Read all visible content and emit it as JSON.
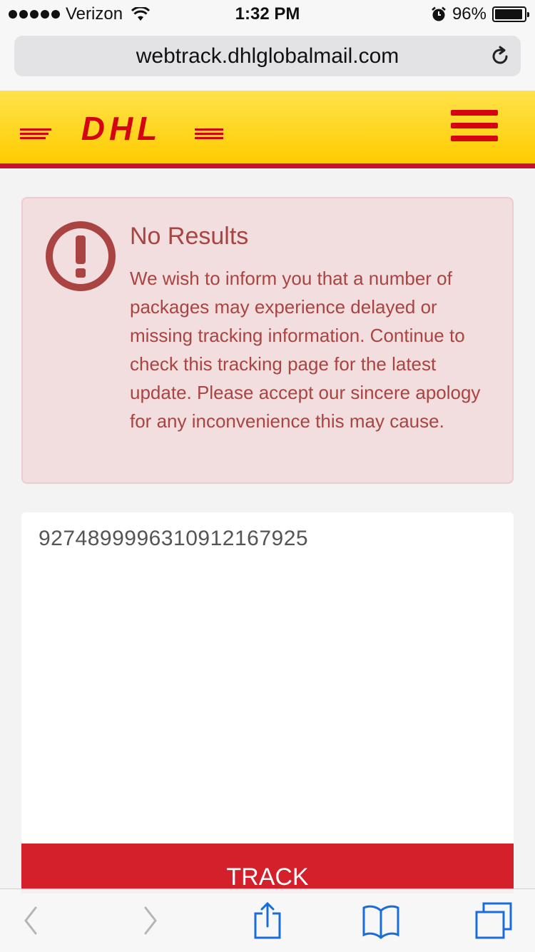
{
  "status_bar": {
    "carrier": "Verizon",
    "time": "1:32 PM",
    "battery": "96%",
    "battery_level": 0.96
  },
  "browser": {
    "url": "webtrack.dhlglobalmail.com"
  },
  "header": {
    "logo_text": "DHL",
    "brand_color": "#d40511",
    "background_color": "#ffcc00"
  },
  "alert": {
    "title": "No Results",
    "body": "We wish to inform you that a number of packages may experience delayed or missing tracking information. Continue to check this tracking page for the latest update. Please accept our sincere apology for any inconvenience this may cause.",
    "color": "#a94442"
  },
  "tracking": {
    "number": "9274899996310912167925",
    "button_label": "TRACK"
  },
  "toolbar": {
    "icons": [
      "back-icon",
      "forward-icon",
      "share-icon",
      "bookmarks-icon",
      "tabs-icon"
    ]
  }
}
